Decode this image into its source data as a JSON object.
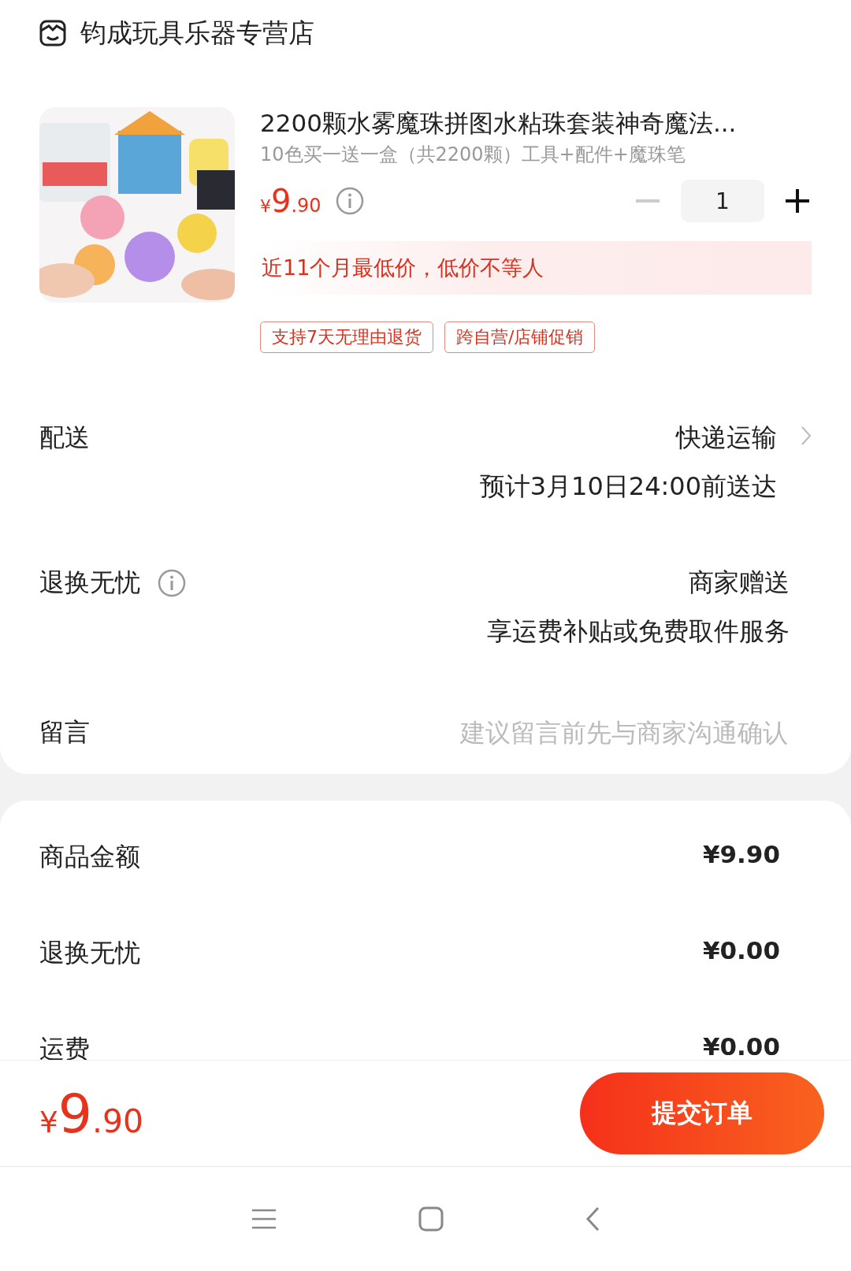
{
  "store": {
    "name": "钧成玩具乐器专营店"
  },
  "product": {
    "title": "2200颗水雾魔珠拼图水粘珠套装神奇魔法...",
    "variant": "10色买一送一盒（共2200颗）工具+配件+魔珠笔",
    "price": {
      "symbol": "¥",
      "integer": "9",
      "decimal": ".90"
    },
    "quantity": "1",
    "decrease_disabled": true,
    "promo": "近11个月最低价，低价不等人",
    "tags": [
      "支持7天无理由退货",
      "跨自营/店铺促销"
    ]
  },
  "options": [
    {
      "kind": "link",
      "label": "配送",
      "value": "快递运输",
      "note": "预计3月10日24:00前送达"
    },
    {
      "kind": "info",
      "label": "退换无忧",
      "value": "商家赠送",
      "note": "享运费补贴或免费取件服务"
    },
    {
      "kind": "input",
      "label": "留言",
      "placeholder": "建议留言前先与商家沟通确认"
    }
  ],
  "summary": [
    {
      "label": "商品金额",
      "value": "¥9.90"
    },
    {
      "label": "退换无忧",
      "value": "¥0.00"
    },
    {
      "label": "运费",
      "value": "¥0.00"
    }
  ],
  "footer": {
    "total": {
      "symbol": "¥",
      "integer": "9",
      "decimal": ".90"
    },
    "submit": "提交订单"
  }
}
